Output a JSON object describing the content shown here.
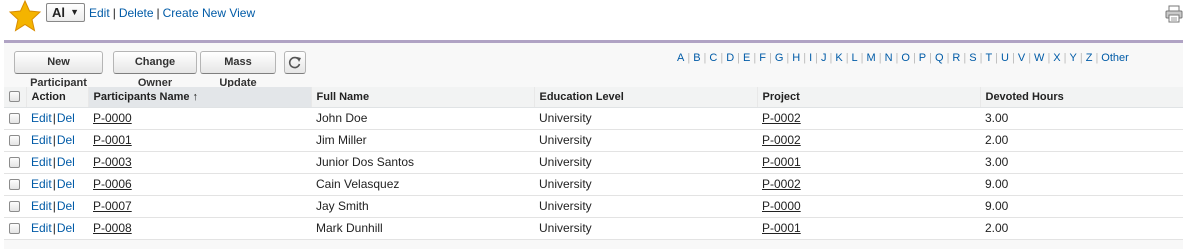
{
  "view": {
    "selected": "Al",
    "links": [
      "Edit",
      "Delete",
      "Create New View"
    ]
  },
  "toolbar": {
    "new_participant": "New Participant",
    "change_owner": "Change Owner",
    "mass_update": "Mass Update"
  },
  "alphabet": [
    "A",
    "B",
    "C",
    "D",
    "E",
    "F",
    "G",
    "H",
    "I",
    "J",
    "K",
    "L",
    "M",
    "N",
    "O",
    "P",
    "Q",
    "R",
    "S",
    "T",
    "U",
    "V",
    "W",
    "X",
    "Y",
    "Z",
    "Other"
  ],
  "table": {
    "headers": {
      "action": "Action",
      "name": "Participants Name",
      "sort_arrow": "↑",
      "full_name": "Full Name",
      "education": "Education Level",
      "project": "Project",
      "hours": "Devoted Hours"
    },
    "rows": [
      {
        "edit": "Edit",
        "del": "Del",
        "name": "P-0000",
        "full_name": "John Doe",
        "education": "University",
        "project": "P-0002",
        "hours": "3.00"
      },
      {
        "edit": "Edit",
        "del": "Del",
        "name": "P-0001",
        "full_name": "Jim Miller",
        "education": "University",
        "project": "P-0002",
        "hours": "2.00"
      },
      {
        "edit": "Edit",
        "del": "Del",
        "name": "P-0003",
        "full_name": "Junior Dos Santos",
        "education": "University",
        "project": "P-0001",
        "hours": "3.00"
      },
      {
        "edit": "Edit",
        "del": "Del",
        "name": "P-0006",
        "full_name": "Cain Velasquez",
        "education": "University",
        "project": "P-0002",
        "hours": "9.00"
      },
      {
        "edit": "Edit",
        "del": "Del",
        "name": "P-0007",
        "full_name": "Jay Smith",
        "education": "University",
        "project": "P-0000",
        "hours": "9.00"
      },
      {
        "edit": "Edit",
        "del": "Del",
        "name": "P-0008",
        "full_name": "Mark Dunhill",
        "education": "University",
        "project": "P-0001",
        "hours": "2.00"
      }
    ]
  },
  "icons": {
    "star": "star-icon",
    "print": "print-icon",
    "refresh": "refresh-icon"
  },
  "colors": {
    "link": "#015ba7",
    "panel_border": "#b0a3c4",
    "star": "#f4b400"
  }
}
